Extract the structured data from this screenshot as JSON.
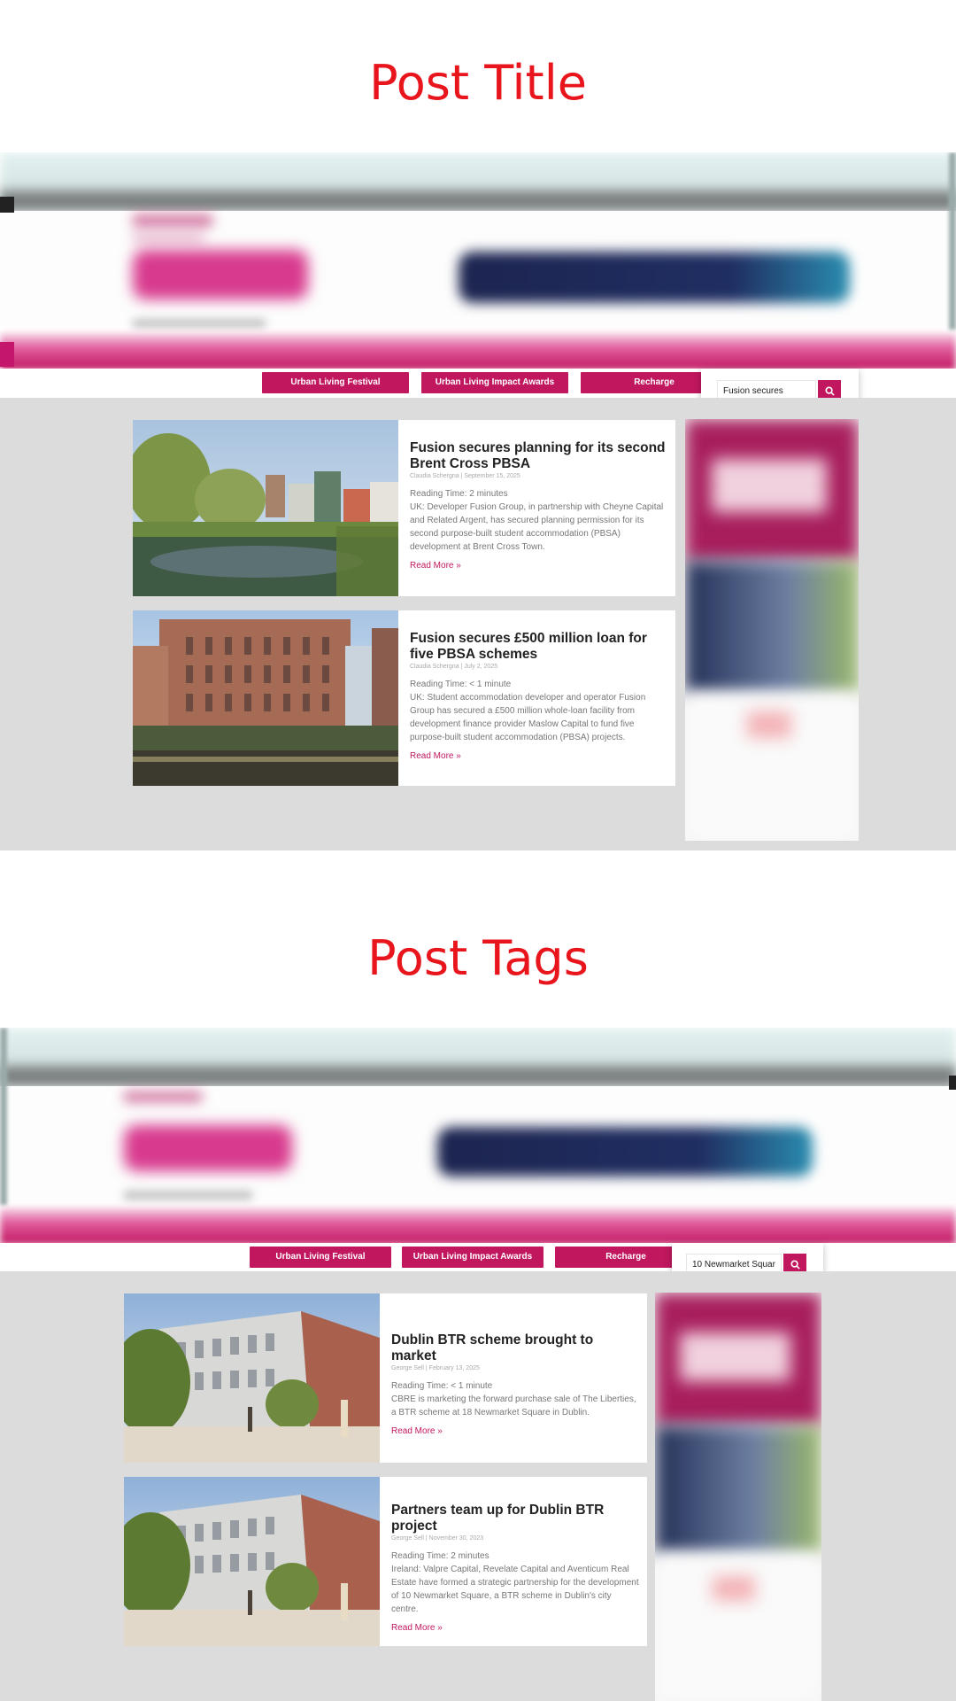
{
  "sections": [
    {
      "heading": "Post Title",
      "nav_buttons": [
        "Urban Living Festival",
        "Urban Living Impact Awards",
        "Recharge"
      ],
      "search_value": "Fusion secures",
      "posts": [
        {
          "title": "Fusion secures planning for its second Brent Cross PBSA",
          "meta": "Claudia Schergna | September 15, 2025",
          "reading_time": "Reading Time: 2 minutes",
          "excerpt": "UK: Developer Fusion Group, in partnership with Cheyne Capital and Related Argent, has secured planning permission for its second purpose-built student accommodation (PBSA) development at Brent Cross Town.",
          "read_more": "Read More »"
        },
        {
          "title": "Fusion secures £500 million loan for five PBSA schemes",
          "meta": "Claudia Schergna | July 2, 2025",
          "reading_time": "Reading Time: < 1 minute",
          "excerpt": "UK: Student accommodation developer and operator Fusion Group has secured a £500 million whole-loan facility from development finance provider Maslow Capital to fund five purpose-built student accommodation (PBSA) projects.",
          "read_more": "Read More »"
        }
      ]
    },
    {
      "heading": "Post Tags",
      "nav_buttons": [
        "Urban Living Festival",
        "Urban Living Impact Awards",
        "Recharge"
      ],
      "search_value": "10 Newmarket Squar",
      "posts": [
        {
          "title": "Dublin BTR scheme brought to market",
          "meta": "George Sell | February 13, 2025",
          "reading_time": "Reading Time: < 1 minute",
          "excerpt": "CBRE is marketing the forward purchase sale of The Liberties, a BTR scheme at 18 Newmarket Square in Dublin.",
          "read_more": "Read More »"
        },
        {
          "title": "Partners team up for Dublin BTR project",
          "meta": "George Sell | November 30, 2023",
          "reading_time": "Reading Time: 2 minutes",
          "excerpt": "Ireland: Valpre Capital, Revelate Capital and Aventicum Real Estate have formed a strategic partnership for the development of 10 Newmarket Square, a BTR scheme in Dublin's city centre.",
          "read_more": "Read More »"
        }
      ]
    }
  ],
  "colors": {
    "heading": "#e8151c",
    "accent": "#c0175f",
    "content_bg": "#dcdcdc"
  },
  "icons": {
    "search": "search-icon"
  }
}
